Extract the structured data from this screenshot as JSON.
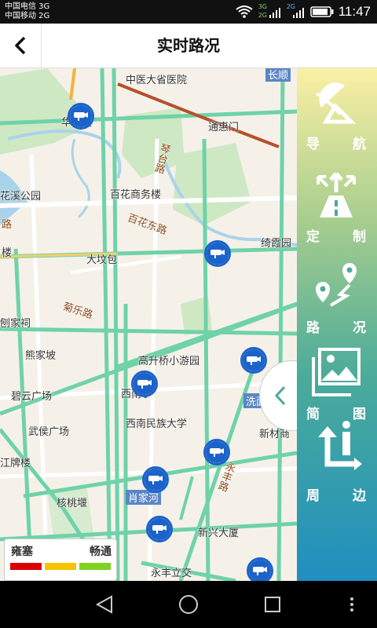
{
  "status_bar": {
    "carrier_1": "中国电信 3G",
    "carrier_2": "中国移动 2G",
    "net_1": "3G",
    "net_2": "2G",
    "net_3": "2G",
    "clock": "11:47"
  },
  "header": {
    "title": "实时路况",
    "back_icon": "chevron-left-icon"
  },
  "map": {
    "labels": {
      "hospital": "中医大省医院",
      "changshun": "长顺",
      "huadasha": "华大厦",
      "tonghuimen": "通惠门",
      "qintai": "琴台路",
      "huaxigongyuan": "花溪公园",
      "baihuashangwulou": "百花商务楼",
      "baihuadonglu": "百花东路",
      "road_left": "路",
      "qixiayuan": "绮霞园",
      "lou": "楼",
      "dadibao": "大坟包",
      "julelu": "菊乐路",
      "jiaci": "刨家祠",
      "xiongjiapo": "熊家坡",
      "gaosheng": "高升桥小游园",
      "biyun": "碧云广场",
      "xinanxue": "西南学",
      "ximianqiao": "洗面桥",
      "xinan_minzu": "西南民族大学",
      "wuhou": "武侯广场",
      "xincai": "新材商",
      "paifang": "江牌楼",
      "xiaojiahe": "肖家河",
      "yongfeng_rd": "永丰路",
      "hetaoyan": "核桃堰",
      "xinxing": "新兴大厦",
      "yongfeng_lijiao": "永丰立交"
    }
  },
  "legend": {
    "left_label": "雍塞",
    "right_label": "畅通",
    "colors": [
      "#d90000",
      "#f4c400",
      "#7ed321"
    ]
  },
  "side_menu": {
    "items": [
      {
        "label_1": "导",
        "label_2": "航",
        "icon": "satellite-dish-icon"
      },
      {
        "label_1": "定",
        "label_2": "制",
        "icon": "road-direction-icon"
      },
      {
        "label_1": "路",
        "label_2": "况",
        "icon": "route-pin-icon"
      },
      {
        "label_1": "简",
        "label_2": "图",
        "icon": "image-icon"
      },
      {
        "label_1": "周",
        "label_2": "边",
        "icon": "info-arrow-icon"
      }
    ]
  },
  "colors": {
    "camera_blue": "#1b63c9",
    "road_green": "#6fd2a8",
    "map_bg": "#f5f1e9"
  }
}
